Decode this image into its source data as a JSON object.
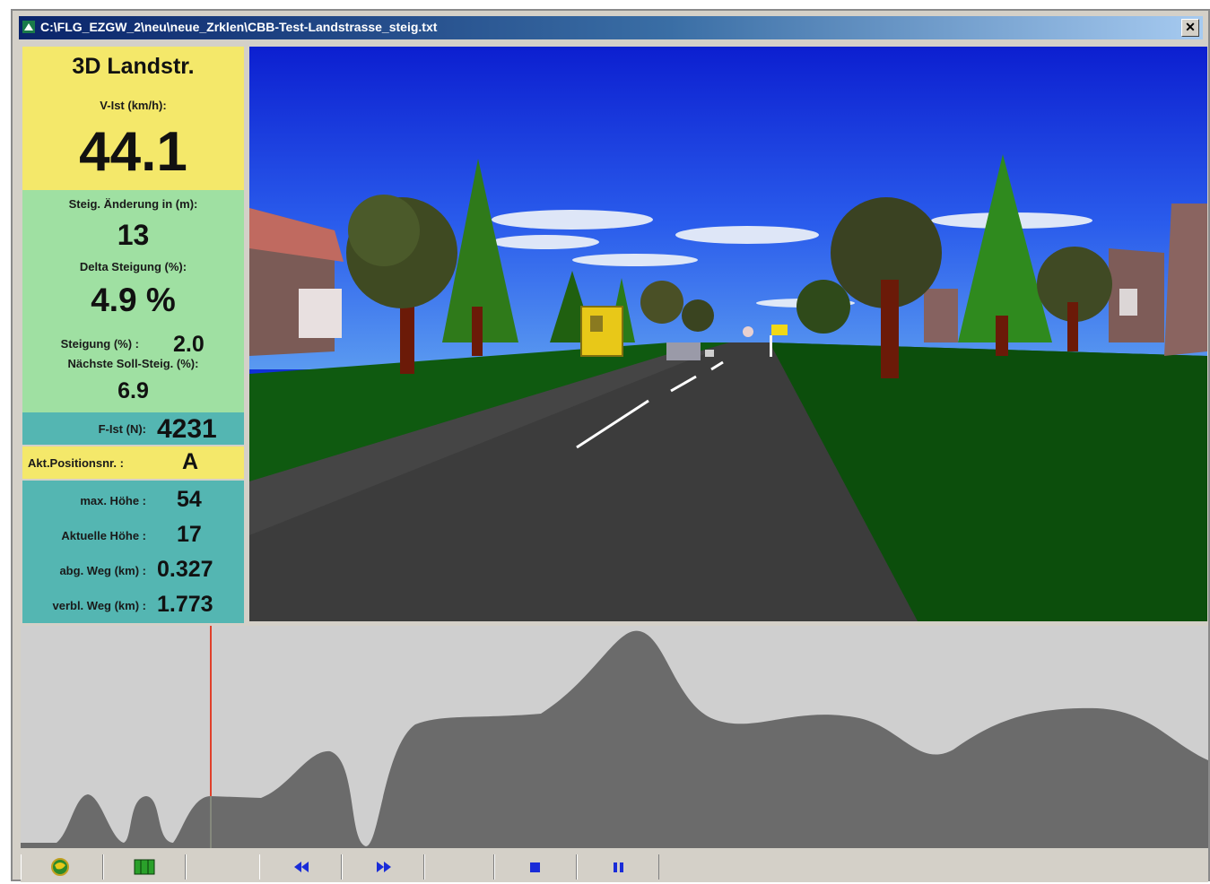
{
  "window": {
    "title": "C:\\FLG_EZGW_2\\neu\\neue_Zrklen\\CBB-Test-Landstrasse_steig.txt",
    "close_glyph": "✕"
  },
  "panel": {
    "scene_name": "3D Landstr.",
    "speed_label": "V-Ist (km/h):",
    "speed_value": "44.1",
    "slope_change_label": "Steig. Änderung in (m):",
    "slope_change_value": "13",
    "delta_slope_label": "Delta Steigung (%):",
    "delta_slope_value": "4.9 %",
    "slope_label": "Steigung (%) :",
    "slope_value": "2.0",
    "next_target_label": "Nächste Soll-Steig. (%):",
    "next_target_value": "6.9",
    "f_ist_label": "F-Ist (N):",
    "f_ist_value": "4231",
    "position_label": "Akt.Positionsnr. :",
    "position_value": "A",
    "max_height_label": "max. Höhe :",
    "max_height_value": "54",
    "current_height_label": "Aktuelle Höhe :",
    "current_height_value": "17",
    "distance_done_label": "abg. Weg (km) :",
    "distance_done_value": "0.327",
    "distance_left_label": "verbl. Weg (km) :",
    "distance_left_value": "1.773"
  },
  "profile": {
    "position_fraction": 0.16,
    "fill_color": "#6b6b6b",
    "marker_color": "#e0402a"
  },
  "toolbar": {
    "buttons": [
      {
        "name": "globe-icon"
      },
      {
        "name": "map-icon"
      },
      {
        "name": "rewind-icon"
      },
      {
        "name": "fast-forward-icon"
      },
      {
        "name": "stop-icon"
      },
      {
        "name": "pause-icon"
      }
    ]
  },
  "colors": {
    "yellow": "#f4e86a",
    "green": "#9fe0a2",
    "teal": "#54b6b2",
    "icon_blue": "#1a2cd8"
  }
}
